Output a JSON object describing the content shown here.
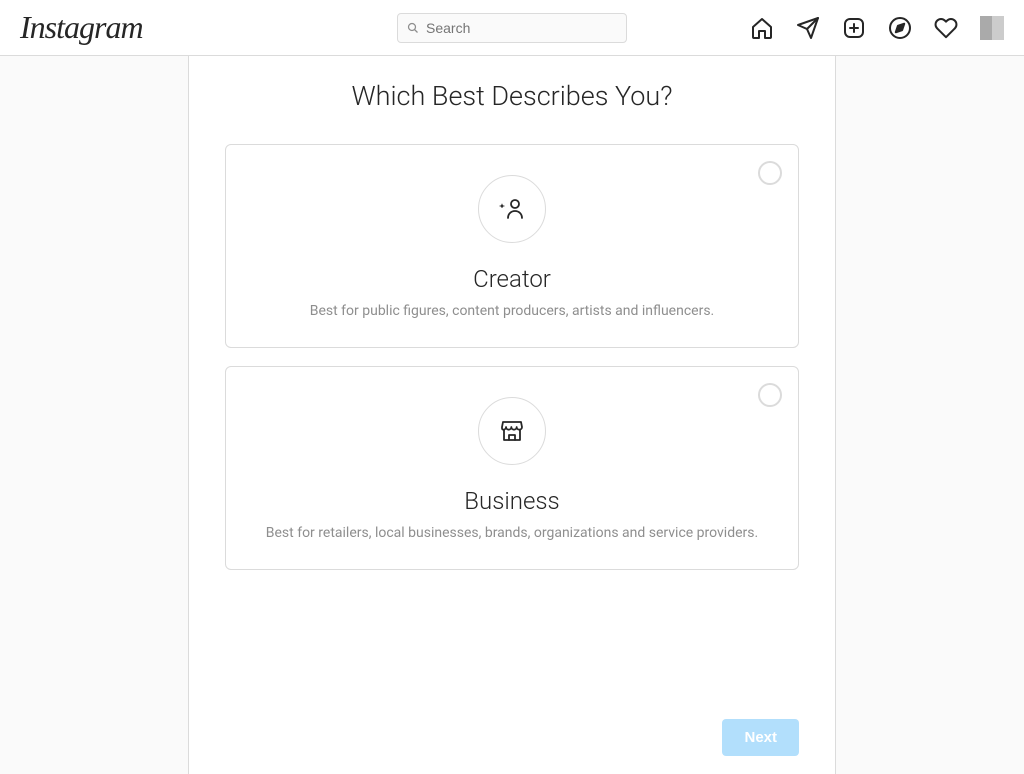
{
  "brand": "Instagram",
  "search": {
    "placeholder": "Search"
  },
  "page": {
    "title": "Which Best Describes You?"
  },
  "options": {
    "creator": {
      "title": "Creator",
      "description": "Best for public figures, content producers, artists and influencers."
    },
    "business": {
      "title": "Business",
      "description": "Best for retailers, local businesses, brands, organizations and service providers."
    }
  },
  "buttons": {
    "next": "Next"
  }
}
